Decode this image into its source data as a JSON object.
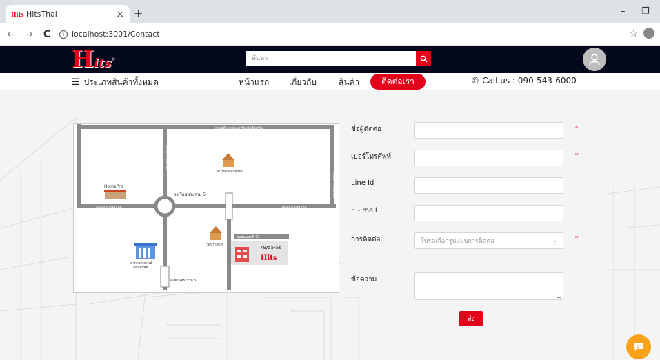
{
  "browser": {
    "tab_title": "HitsThai",
    "tab_close": "×",
    "new_tab": "+",
    "minimize": "–",
    "restore": "❐",
    "back": "←",
    "forward": "→",
    "reload": "C",
    "url": "localhost:3001/Contact",
    "bookmark": "☆",
    "info_glyph": "i"
  },
  "header": {
    "logo_h": "H",
    "logo_rest": "its",
    "logo_reg": "®",
    "search_placeholder": "ค้นหา"
  },
  "nav": {
    "categories_label": "ประเภทสินค้าทั้งหมด",
    "burger": "☰",
    "items": [
      {
        "label": "หน้าแรก"
      },
      {
        "label": "เกี่ยวกับ"
      },
      {
        "label": "สินค้า"
      },
      {
        "label": "ติดต่อเรา"
      }
    ],
    "phone_glyph": "✆",
    "call_us": "Call us : 090-543-6000"
  },
  "map": {
    "road_top": "ถนนเลียบคลองภาษีเจริญฝั่งเหนือ",
    "road_middle_left": "ถนนบางขุนพรหม",
    "road_middle_right": "ถนนบางขุนพรหม",
    "road_left_vertical": "ถนนบางขุนพรหม",
    "road_right_vertical": "ถนนบางขุนพรหม",
    "roundabout_label": "วงเวียนพระราม 5",
    "temple_top": "วัดโบสถ์ดอนพรหม",
    "temple_bottom": "วัดปราสาท",
    "soi_label": "ซอยนนทบุรี 42",
    "homepro": "HomePro",
    "bank_line1": "อาคารสหกรณ์",
    "bank_line2": "ออมทรัพย์",
    "bridge_label": "สะพานพระราม 5",
    "address": "79/55-56",
    "hits_mark": "Hits"
  },
  "form": {
    "contact_name_label": "ชื่อผู้ติดต่อ",
    "phone_label": "เบอร์โทรศัพท์",
    "line_label": "Line Id",
    "email_label": "E - mail",
    "contact_type_label": "การติดต่อ",
    "contact_type_placeholder": "โปรดเลือกรูปแบบการติดต่อ",
    "message_label": "ข้อความ",
    "required_mark": "*",
    "chevron": "⌄",
    "submit_label": "ส่ง"
  },
  "colors": {
    "brand_red": "#e3001b",
    "header_bg": "#05091e",
    "chat_orange": "#f9a21a"
  }
}
